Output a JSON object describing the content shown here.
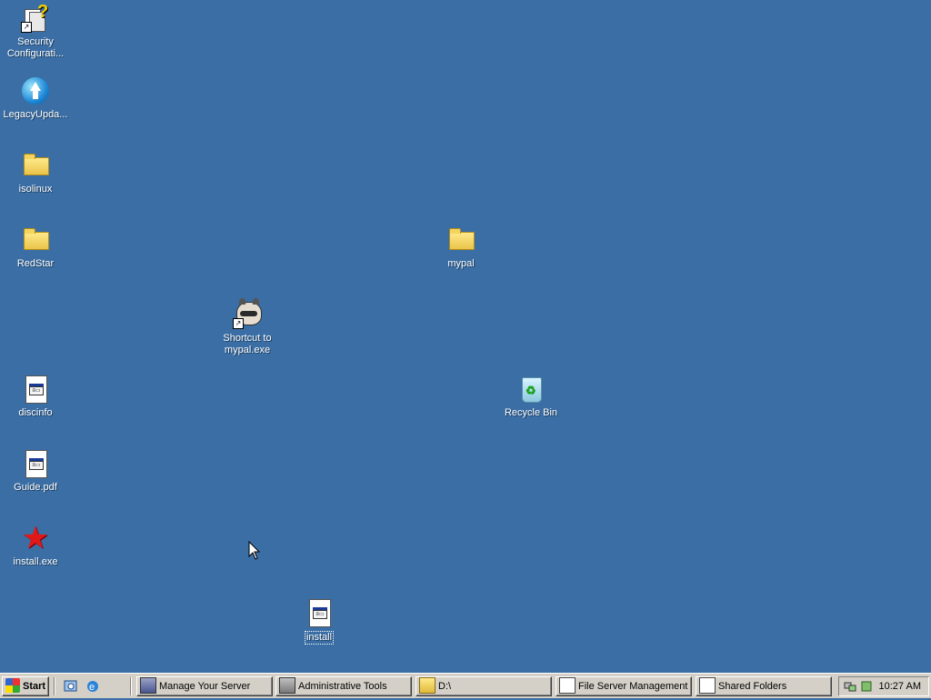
{
  "desktop": {
    "background_color": "#3a6ea5",
    "icons": {
      "security_config": {
        "label": "Security Configurati...",
        "icon": "security-config-icon"
      },
      "legacy_update": {
        "label": "LegacyUpda...",
        "icon": "globe-update-icon"
      },
      "isolinux": {
        "label": "isolinux",
        "icon": "folder-icon"
      },
      "redstar": {
        "label": "RedStar",
        "icon": "folder-icon"
      },
      "mypal_folder": {
        "label": "mypal",
        "icon": "folder-icon"
      },
      "mypal_shortcut": {
        "label": "Shortcut to mypal.exe",
        "icon": "raccoon-icon"
      },
      "discinfo": {
        "label": "discinfo",
        "icon": "document-icon"
      },
      "recycle_bin": {
        "label": "Recycle Bin",
        "icon": "recycle-bin-icon"
      },
      "guide_pdf": {
        "label": "Guide.pdf",
        "icon": "document-icon"
      },
      "install_exe": {
        "label": "install.exe",
        "icon": "star-icon"
      },
      "install": {
        "label": "install",
        "icon": "document-icon"
      }
    }
  },
  "taskbar": {
    "start_label": "Start",
    "windows": [
      {
        "label": "Manage Your Server",
        "icon": "server-icon"
      },
      {
        "label": "Administrative Tools",
        "icon": "admin-tools-icon"
      },
      {
        "label": "D:\\",
        "icon": "folder-icon"
      },
      {
        "label": "File Server Management",
        "icon": "file-server-icon"
      },
      {
        "label": "Shared Folders",
        "icon": "shared-folders-icon"
      }
    ],
    "clock": "10:27 AM"
  }
}
